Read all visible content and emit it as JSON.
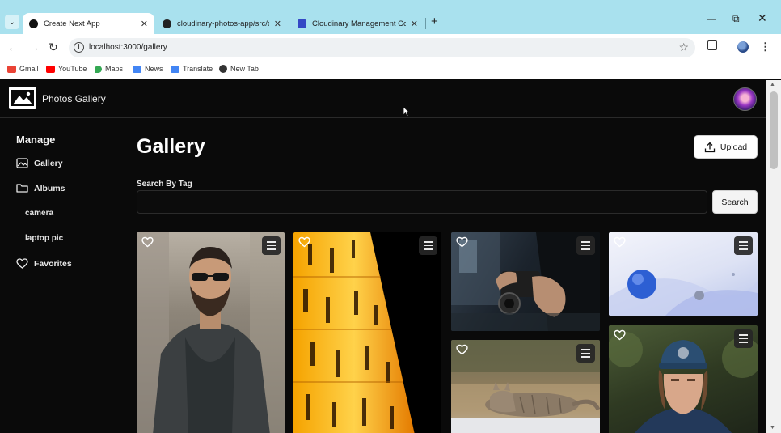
{
  "browser": {
    "tabs": [
      {
        "title": "Create Next App",
        "active": true,
        "favicon": "nextjs-icon"
      },
      {
        "title": "cloudinary-photos-app/src/cor",
        "active": false,
        "favicon": "github-icon"
      },
      {
        "title": "Cloudinary Management Conso",
        "active": false,
        "favicon": "cloudinary-icon"
      }
    ],
    "url": "localhost:3000/gallery",
    "bookmarks": [
      {
        "label": "Gmail",
        "color": "#ea4335"
      },
      {
        "label": "YouTube",
        "color": "#ff0000"
      },
      {
        "label": "Maps",
        "color": "#34a853"
      },
      {
        "label": "News",
        "color": "#4285f4"
      },
      {
        "label": "Translate",
        "color": "#4285f4"
      },
      {
        "label": "New Tab",
        "color": "#333333"
      }
    ]
  },
  "app": {
    "brand": "Photos Gallery",
    "sidebar": {
      "title": "Manage",
      "items": [
        {
          "label": "Gallery",
          "icon": "image-icon"
        },
        {
          "label": "Albums",
          "icon": "folder-icon"
        },
        {
          "label": "camera"
        },
        {
          "label": "laptop pic"
        },
        {
          "label": "Favorites",
          "icon": "heart-icon"
        }
      ]
    },
    "main": {
      "title": "Gallery",
      "upload_label": "Upload",
      "search_label": "Search By Tag",
      "search_value": "",
      "search_button": "Search"
    }
  },
  "colors": {
    "browser_tabbar": "#a9e1ee",
    "app_background": "#0a0a0a",
    "text_primary": "#ffffff"
  }
}
